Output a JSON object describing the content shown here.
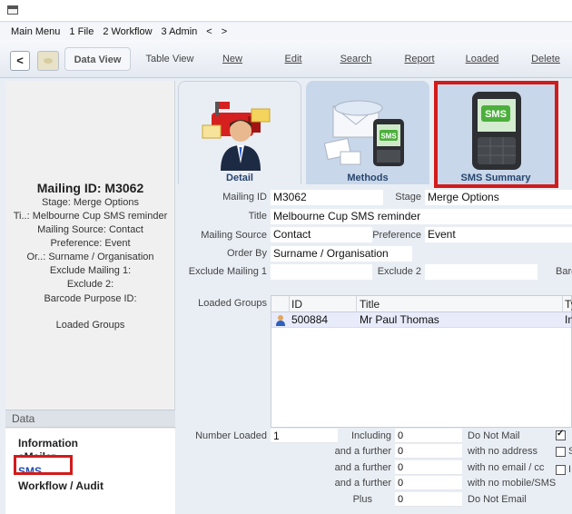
{
  "menu": [
    "Main Menu",
    "1 File",
    "2 Workflow",
    "3 Admin",
    "<",
    ">"
  ],
  "toolbar": {
    "back": "<",
    "data_view": "Data View",
    "table_view": "Table View",
    "new": "New",
    "edit": "Edit",
    "search": "Search",
    "report": "Report",
    "loaded": "Loaded",
    "delete": "Delete"
  },
  "record": {
    "title": "Mailing ID: M3062",
    "lines": [
      "Stage: Merge Options",
      "Ti..: Melbourne Cup SMS reminder",
      "Mailing Source: Contact",
      "Preference: Event",
      "Or..: Surname / Organisation",
      "Exclude Mailing 1:",
      "Exclude 2:",
      "Barcode Purpose ID:",
      "",
      "Loaded Groups"
    ]
  },
  "data_panel": {
    "heading": "Data",
    "items": [
      "Information",
      "eMailer",
      "SMS",
      "Workflow / Audit"
    ]
  },
  "tabs": [
    "Detail",
    "Methods",
    "SMS Summary"
  ],
  "form": {
    "mailing_id_label": "Mailing ID",
    "mailing_id": "M3062",
    "stage_label": "Stage",
    "stage": "Merge Options",
    "title_label": "Title",
    "title": "Melbourne Cup SMS reminder",
    "source_label": "Mailing Source",
    "source": "Contact",
    "preference_label": "Preference",
    "preference": "Event",
    "order_label": "Order By",
    "order": "Surname / Organisation",
    "excl1_label": "Exclude Mailing 1",
    "excl1": "",
    "excl2_label": "Exclude 2",
    "excl2": "",
    "barcode_label": "Barc"
  },
  "groups": {
    "label": "Loaded Groups",
    "columns": [
      "ID",
      "Title",
      "Ty"
    ],
    "rows": [
      {
        "id": "500884",
        "title": "Mr Paul Thomas",
        "type": "In"
      }
    ]
  },
  "counts": {
    "number_loaded_label": "Number Loaded",
    "number_loaded": "1",
    "rows": [
      {
        "label": "Including",
        "value": "0",
        "desc": "Do Not Mail"
      },
      {
        "label": "and a further",
        "value": "0",
        "desc": "with no address"
      },
      {
        "label": "and a further",
        "value": "0",
        "desc": "with no email / cc"
      },
      {
        "label": "and a further",
        "value": "0",
        "desc": "with no mobile/SMS"
      },
      {
        "label": "Plus",
        "value": "0",
        "desc": "Do Not Email"
      }
    ],
    "checks": [
      {
        "label": "",
        "checked": true
      },
      {
        "label": "S",
        "checked": false
      },
      {
        "label": "I",
        "checked": false
      }
    ]
  },
  "colors": {
    "highlight": "#d21b1b",
    "accent": "#1f4fb5",
    "tab_bg": "#c9d7ea"
  }
}
